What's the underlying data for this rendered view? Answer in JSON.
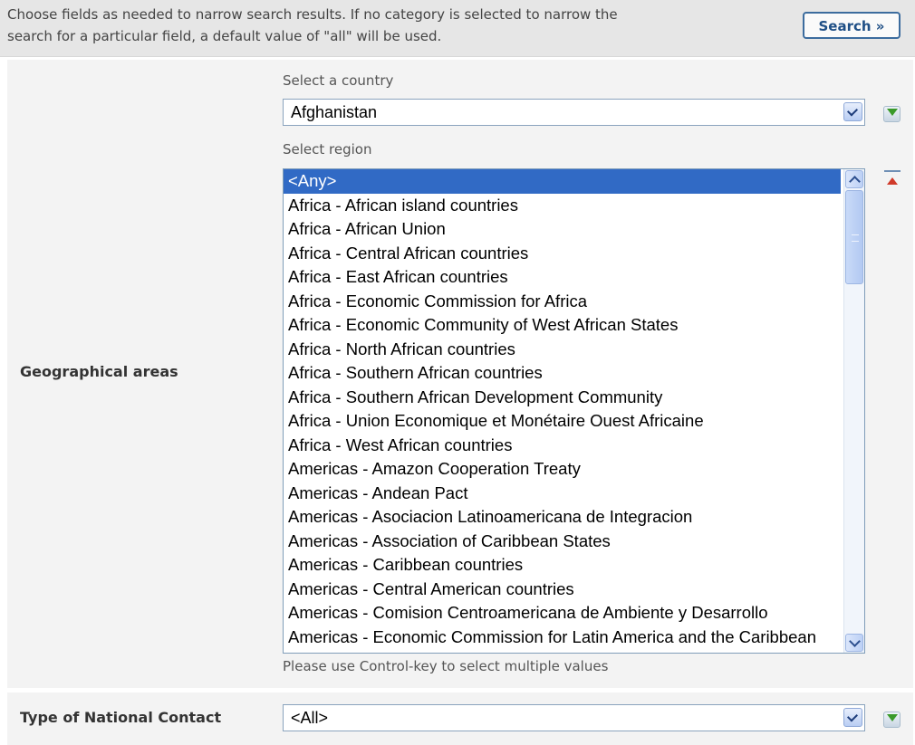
{
  "top": {
    "intro_line1": "Choose fields as needed to narrow search results. If no category is selected to narrow the",
    "intro_line2": "search for a particular field, a default value of \"all\" will be used.",
    "search_label": "Search »"
  },
  "geo": {
    "label": "Geographical areas",
    "country_label": "Select a country",
    "country_value": "Afghanistan",
    "region_label": "Select region",
    "regions": [
      "<Any>",
      "Africa - African island countries",
      "Africa - African Union",
      "Africa - Central African countries",
      "Africa - East African countries",
      "Africa - Economic Commission for Africa",
      "Africa - Economic Community of West African States",
      "Africa - North African countries",
      "Africa - Southern African countries",
      "Africa - Southern African Development Community",
      "Africa - Union Economique et Monétaire Ouest Africaine",
      "Africa - West African countries",
      "Americas - Amazon Cooperation Treaty",
      "Americas - Andean Pact",
      "Americas - Asociacion Latinoamericana de Integracion",
      "Americas - Association of Caribbean States",
      "Americas - Caribbean countries",
      "Americas - Central American countries",
      "Americas - Comision Centroamericana de Ambiente y Desarrollo",
      "Americas - Economic Commission for Latin America and the Caribbean"
    ],
    "hint": "Please use Control-key to select multiple values"
  },
  "contact": {
    "label": "Type of National Contact",
    "value": "<All>"
  },
  "icons": {
    "add": "green-down-arrow-icon",
    "remove": "red-up-arrow-icon"
  },
  "colors": {
    "selected_bg": "#316ac5",
    "search_text": "#1f4f86",
    "add_arrow": "#3a9a2a",
    "remove_arrow": "#d03a2a"
  }
}
